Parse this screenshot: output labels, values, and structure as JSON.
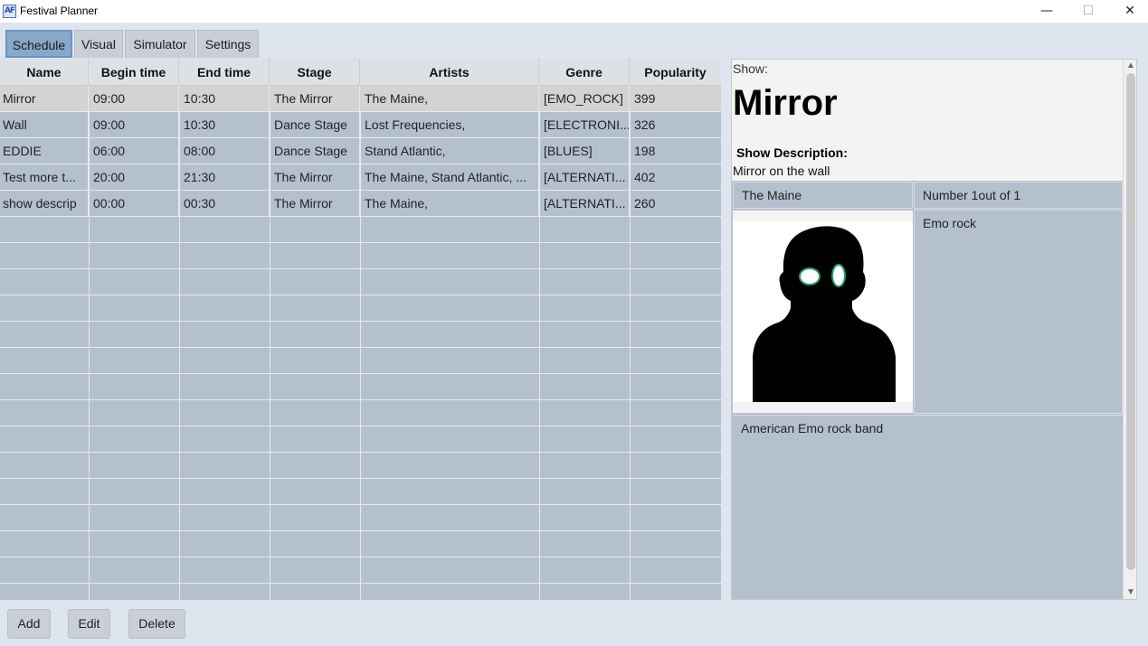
{
  "window": {
    "title": "Festival Planner",
    "icon_text": "AF",
    "minimize_glyph": "—",
    "maximize_glyph": "☐",
    "close_glyph": "✕"
  },
  "tabs": [
    {
      "label": "Schedule",
      "active": true
    },
    {
      "label": "Visual",
      "active": false
    },
    {
      "label": "Simulator",
      "active": false
    },
    {
      "label": "Settings",
      "active": false
    }
  ],
  "table": {
    "columns": [
      "Name",
      "Begin time",
      "End time",
      "Stage",
      "Artists",
      "Genre",
      "Popularity"
    ],
    "rows": [
      [
        "Mirror",
        "09:00",
        "10:30",
        "The Mirror",
        "The Maine,",
        "[EMO_ROCK]",
        "399"
      ],
      [
        "Wall",
        "09:00",
        "10:30",
        "Dance Stage",
        "Lost Frequencies,",
        "[ELECTRONI...",
        "326"
      ],
      [
        "EDDIE",
        "06:00",
        "08:00",
        "Dance Stage",
        "Stand Atlantic,",
        "[BLUES]",
        "198"
      ],
      [
        "Test more t...",
        "20:00",
        "21:30",
        "The Mirror",
        "The Maine, Stand Atlantic, ...",
        "[ALTERNATI...",
        "402"
      ],
      [
        "show descrip",
        "00:00",
        "00:30",
        "The Mirror",
        "The Maine,",
        "[ALTERNATI...",
        "260"
      ]
    ],
    "selected_row": 0
  },
  "detail": {
    "show_label": "Show:",
    "show_title": "Mirror",
    "description_label": "Show Description:",
    "description": "Mirror on the wall",
    "artist_name": "The Maine",
    "artist_rank": "Number 1out of 1",
    "artist_genre": "Emo rock",
    "artist_bio": "American Emo rock band",
    "portrait_icon": "person-silhouette-icon",
    "colors": {
      "silhouette": "#000000",
      "eyes": "#ffffff",
      "eye_outline": "#1f9e6a"
    }
  },
  "scroll": {
    "up_glyph": "▲",
    "down_glyph": "▼"
  },
  "buttons": {
    "add": "Add",
    "edit": "Edit",
    "delete": "Delete"
  }
}
